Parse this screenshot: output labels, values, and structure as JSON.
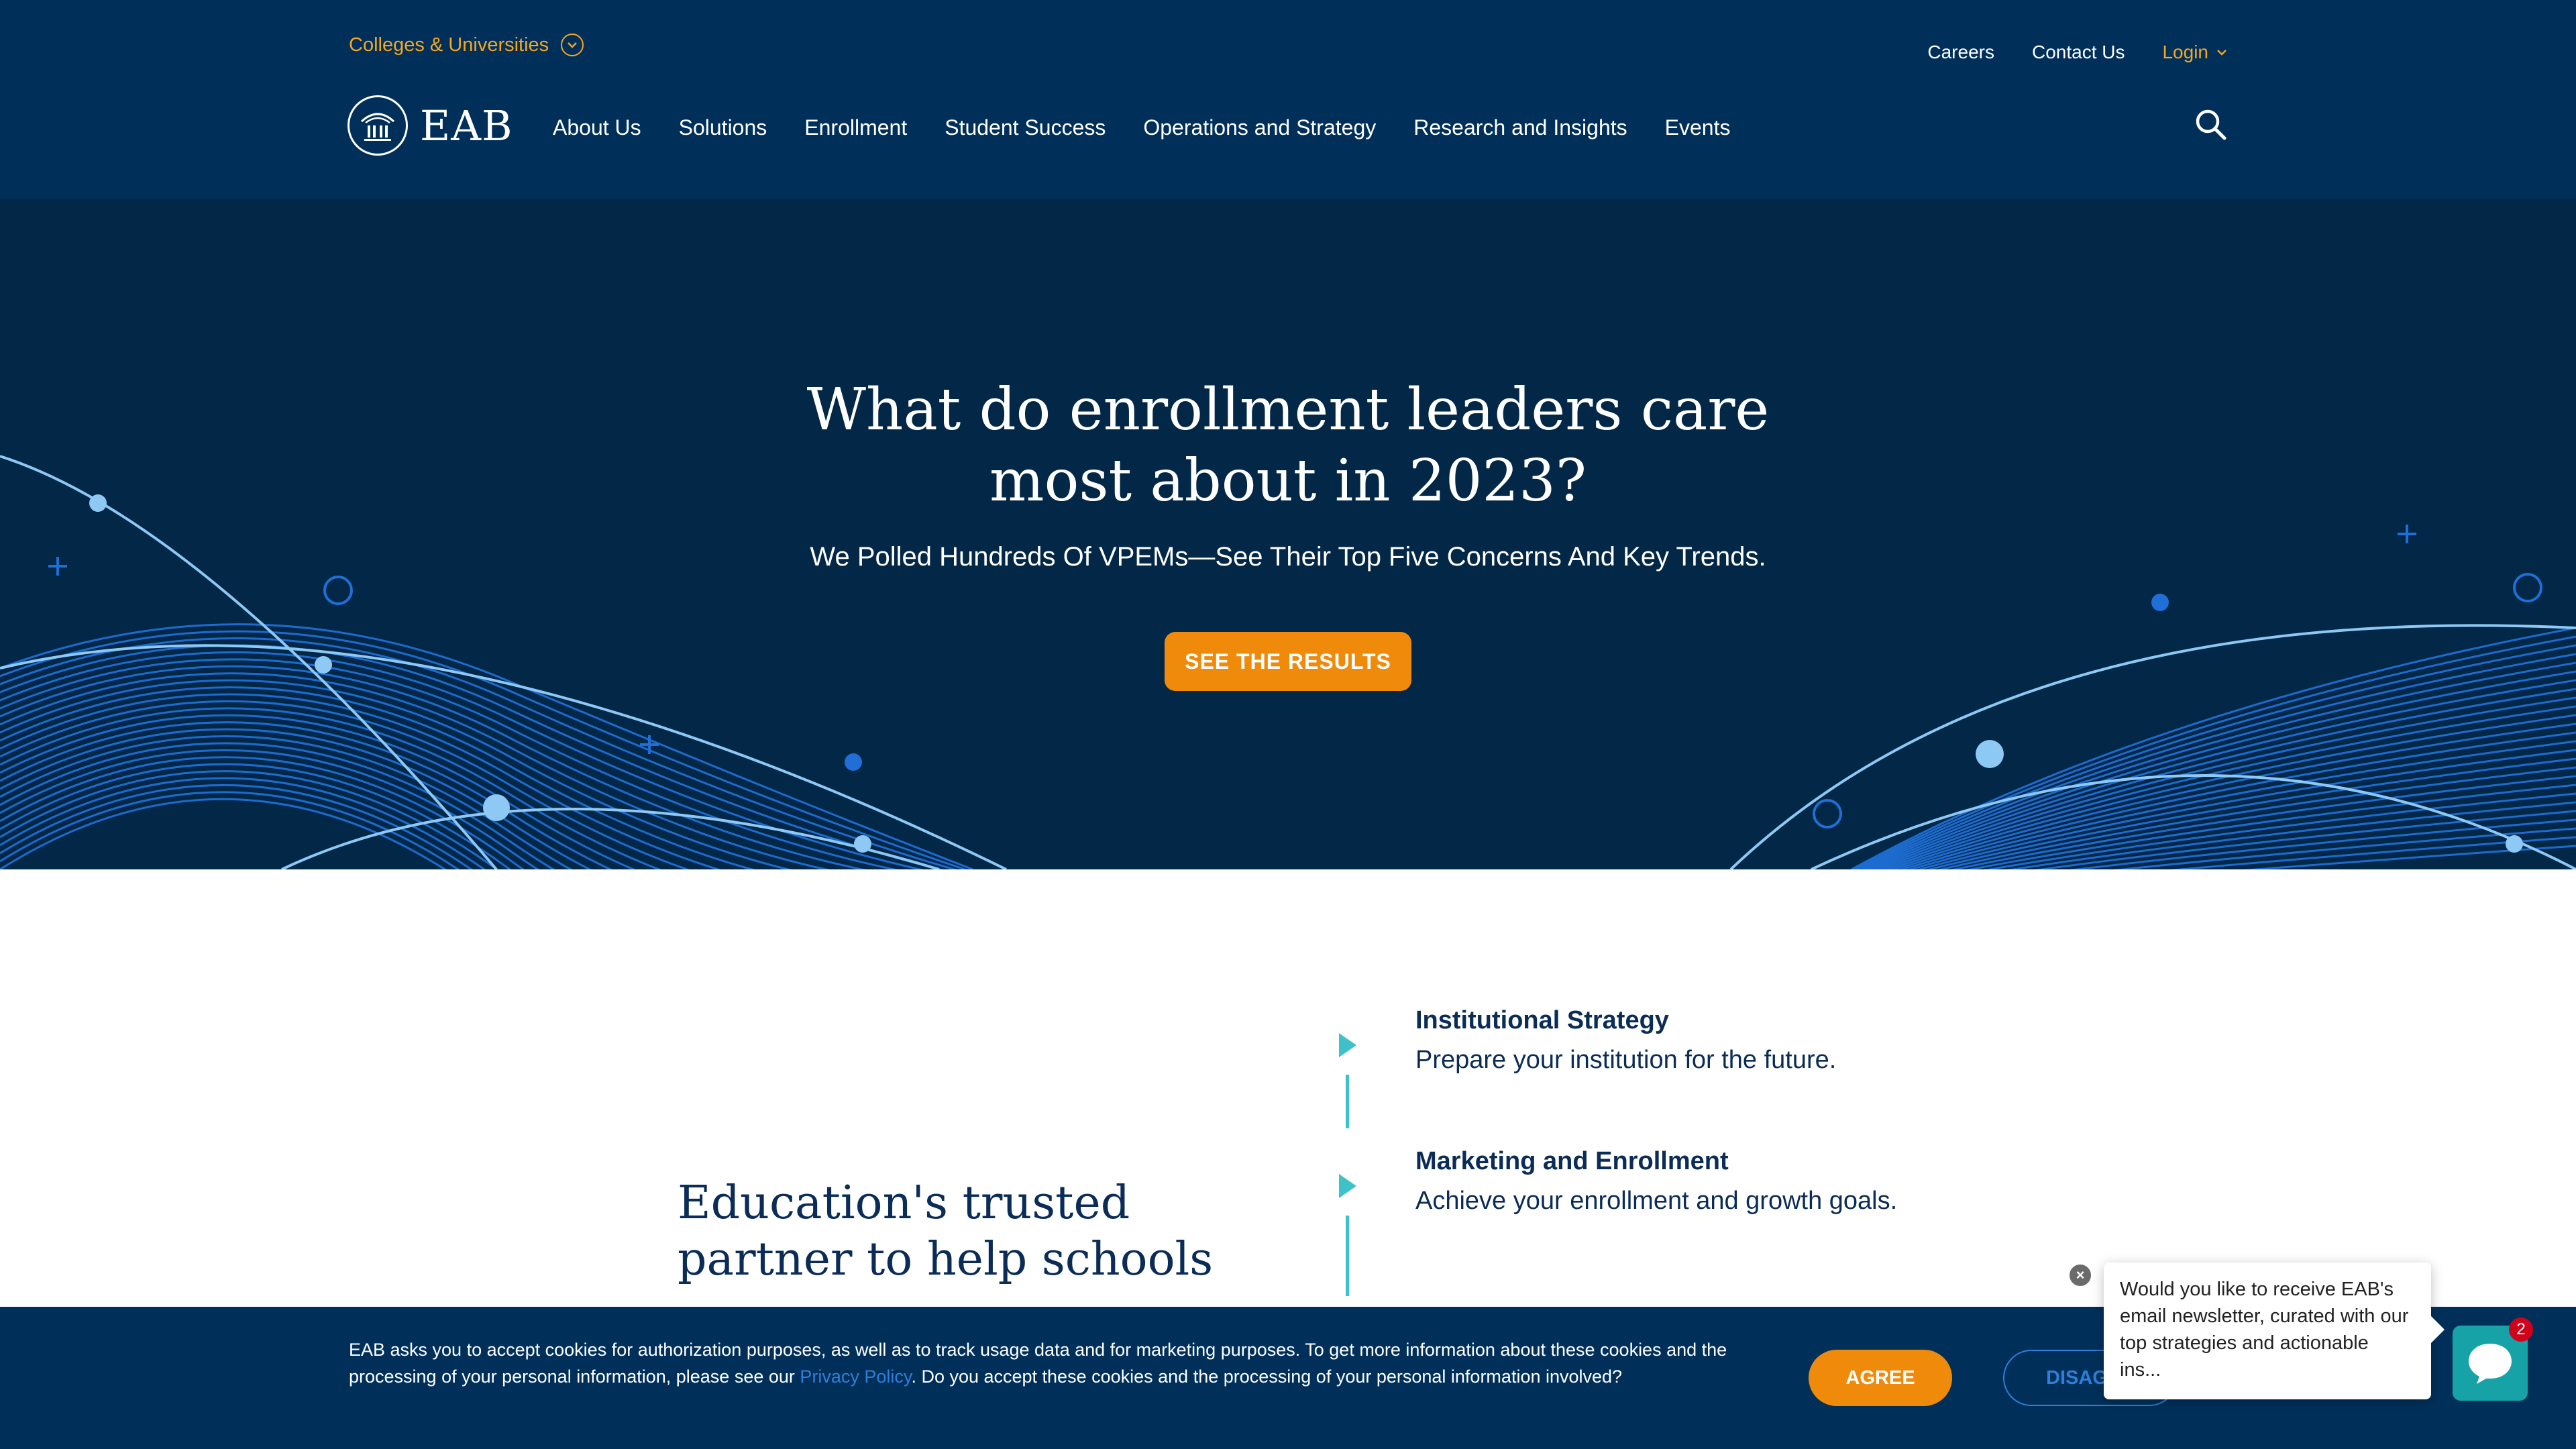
{
  "header": {
    "audience_label": "Colleges & Universities",
    "utility_links": {
      "careers": "Careers",
      "contact": "Contact Us",
      "login": "Login"
    },
    "logo_text": "EAB",
    "nav": [
      "About Us",
      "Solutions",
      "Enrollment",
      "Student Success",
      "Operations and Strategy",
      "Research and Insights",
      "Events"
    ]
  },
  "hero": {
    "title_line1": "What do enrollment leaders care",
    "title_line2": "most about in 2023?",
    "subtitle": "We Polled Hundreds Of VPEMs—See Their Top Five Concerns And Key Trends.",
    "cta": "SEE THE RESULTS"
  },
  "content": {
    "heading_line1": "Education's trusted",
    "heading_line2": "partner to help schools",
    "pillars": [
      {
        "title": "Institutional Strategy",
        "desc": "Prepare your institution for the future."
      },
      {
        "title": "Marketing and Enrollment",
        "desc": "Achieve your enrollment and growth goals."
      }
    ]
  },
  "cookie": {
    "text_before": "EAB asks you to accept cookies for authorization purposes, as well as to track usage data and for marketing purposes. To get more information about these cookies and the processing of your personal information, please see our ",
    "privacy_link": "Privacy Policy",
    "text_after": ". Do you accept these cookies and the processing of your personal information involved?",
    "agree": "AGREE",
    "disagree": "DISAGREE"
  },
  "chat": {
    "message": "Would you like to receive EAB's email newsletter, curated with our top strategies and actionable ins...",
    "badge_count": "2"
  },
  "colors": {
    "header_bg": "#00305a",
    "hero_bg": "#022747",
    "accent_orange": "#f08a0a",
    "teal": "#3fc1c9",
    "link_blue": "#2f7ed8"
  }
}
